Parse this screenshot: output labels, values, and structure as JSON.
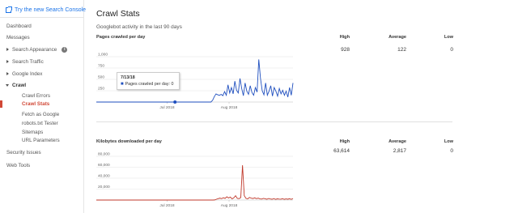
{
  "sidebar": {
    "try_new": "Try the new Search Console",
    "items": [
      {
        "label": "Dashboard"
      },
      {
        "label": "Messages"
      },
      {
        "label": "Search Appearance"
      },
      {
        "label": "Search Traffic"
      },
      {
        "label": "Google Index"
      },
      {
        "label": "Crawl"
      },
      {
        "label": "Crawl Errors"
      },
      {
        "label": "Crawl Stats"
      },
      {
        "label": "Fetch as Google"
      },
      {
        "label": "robots.txt Tester"
      },
      {
        "label": "Sitemaps"
      },
      {
        "label": "URL Parameters"
      },
      {
        "label": "Security Issues"
      },
      {
        "label": "Web Tools"
      }
    ]
  },
  "main": {
    "title": "Crawl Stats",
    "subtitle": "Googlebot activity in the last 90 days",
    "columns": {
      "high": "High",
      "average": "Average",
      "low": "Low"
    },
    "pages": {
      "header": "Pages crawled per day",
      "high": "928",
      "average": "122",
      "low": "0"
    },
    "kb": {
      "header": "Kilobytes downloaded per day",
      "high": "63,614",
      "average": "2,817",
      "low": "0"
    },
    "tooltip": {
      "date": "7/13/18",
      "text": "Pages crawled per day: 0"
    }
  },
  "colors": {
    "pages_line": "#1f4fbf",
    "kb_line": "#c0392b",
    "active": "#d14836"
  },
  "chart_data": [
    {
      "type": "line",
      "title": "Pages crawled per day",
      "x_ticks": [
        "Jul 2018",
        "Aug 2018"
      ],
      "y_ticks": [
        "1,000",
        "750",
        "500",
        "250"
      ],
      "ylim": [
        0,
        1000
      ],
      "series": [
        {
          "values": [
            0,
            0,
            0,
            0,
            0,
            0,
            0,
            0,
            0,
            0,
            0,
            0,
            0,
            0,
            0,
            0,
            0,
            0,
            0,
            0,
            0,
            0,
            0,
            0,
            0,
            0,
            0,
            0,
            0,
            0,
            0,
            0,
            0,
            0,
            0,
            0,
            0,
            0,
            0,
            0,
            0,
            0,
            0,
            0,
            0,
            0,
            0,
            0,
            0,
            0,
            0,
            0,
            0,
            0,
            0,
            0,
            0,
            0,
            0,
            0,
            0,
            0,
            0,
            0,
            0,
            0,
            0,
            0,
            40,
            120,
            180,
            160,
            150,
            170,
            140,
            230,
            150,
            380,
            200,
            320,
            180,
            460,
            260,
            200,
            520,
            300,
            140,
            420,
            240,
            170,
            360,
            210,
            150,
            320,
            220,
            940,
            520,
            250,
            160,
            420,
            150,
            240,
            360,
            130,
            320,
            240,
            130,
            300,
            180,
            260,
            150,
            240,
            110,
            320,
            150,
            420
          ]
        }
      ]
    },
    {
      "type": "line",
      "title": "Kilobytes downloaded per day",
      "x_ticks": [
        "Jul 2018",
        "Aug 2018"
      ],
      "y_ticks": [
        "80,000",
        "60,000",
        "40,000",
        "20,000"
      ],
      "ylim": [
        0,
        80000
      ],
      "series": [
        {
          "values": [
            0,
            0,
            0,
            0,
            0,
            0,
            0,
            0,
            0,
            0,
            0,
            0,
            0,
            0,
            0,
            0,
            0,
            0,
            0,
            0,
            0,
            0,
            0,
            0,
            0,
            0,
            0,
            0,
            0,
            0,
            0,
            0,
            0,
            0,
            0,
            0,
            0,
            0,
            0,
            0,
            0,
            0,
            0,
            0,
            0,
            0,
            0,
            0,
            0,
            0,
            0,
            0,
            0,
            0,
            0,
            0,
            0,
            0,
            0,
            0,
            0,
            0,
            0,
            0,
            0,
            0,
            0,
            0,
            200,
            1500,
            2500,
            3500,
            2500,
            4200,
            3000,
            6000,
            3800,
            5500,
            2200,
            4000,
            8000,
            3000,
            2500,
            4500,
            63614,
            8000,
            3000,
            2200,
            4800,
            3500,
            2800,
            4000,
            2500,
            3500,
            2200,
            1800,
            3000,
            2400,
            1500,
            2800,
            2000,
            1500,
            2600,
            1200,
            2200,
            1800,
            1600,
            2400,
            1300,
            2100,
            1500,
            2400,
            1200,
            2800
          ]
        }
      ]
    }
  ]
}
